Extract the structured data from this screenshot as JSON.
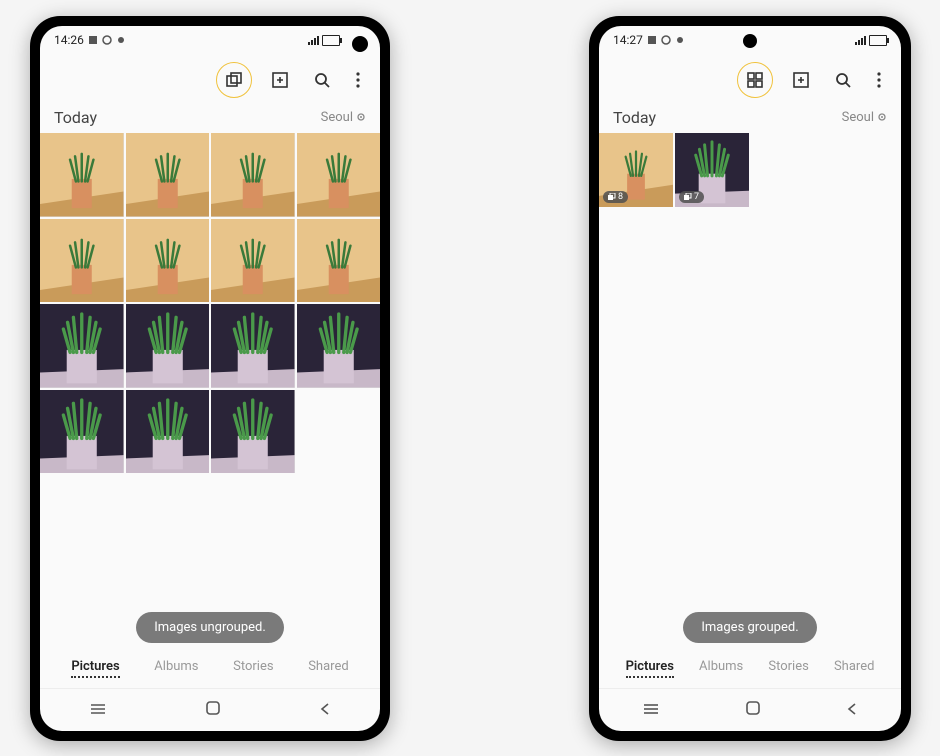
{
  "phones": {
    "left": {
      "status": {
        "time": "14:26",
        "location_city": "Seoul"
      },
      "section_title": "Today",
      "toast": "Images ungrouped.",
      "thumbs_count": 15,
      "tabs": [
        "Pictures",
        "Albums",
        "Stories",
        "Shared"
      ],
      "active_tab": "Pictures"
    },
    "right": {
      "status": {
        "time": "14:27",
        "location_city": "Seoul"
      },
      "section_title": "Today",
      "toast": "Images grouped.",
      "groups": [
        {
          "badge": "8"
        },
        {
          "badge": "7"
        }
      ],
      "tabs": [
        "Pictures",
        "Albums",
        "Stories",
        "Shared"
      ],
      "active_tab": "Pictures"
    }
  }
}
